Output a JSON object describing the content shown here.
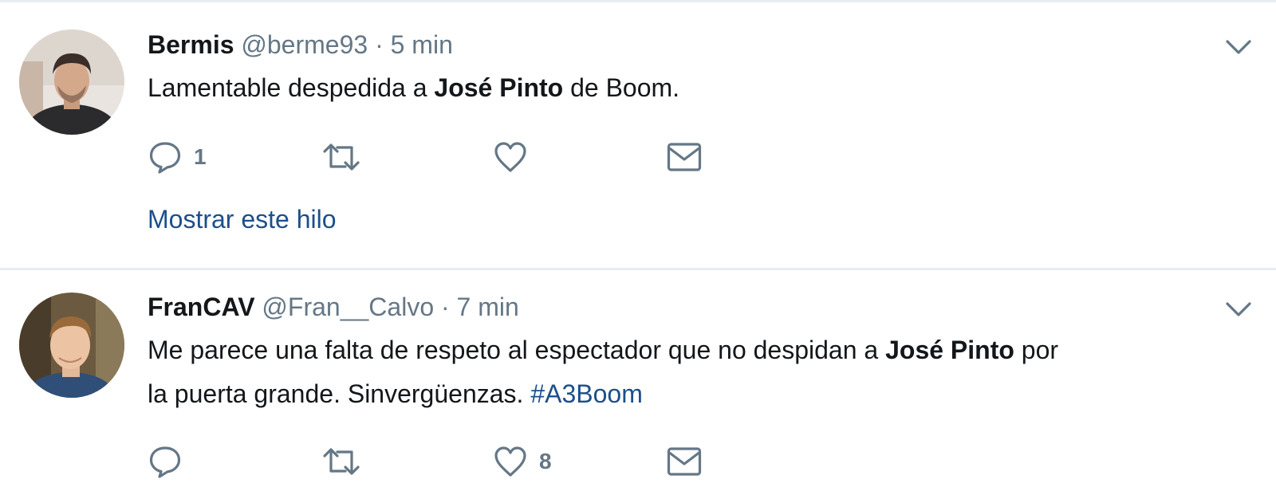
{
  "tweets": [
    {
      "name": "Bermis",
      "handle": "@berme93",
      "separator": "·",
      "time": "5 min",
      "text_parts": [
        "Lamentable despedida a ",
        "José Pinto",
        " de Boom."
      ],
      "reply_count": "1",
      "retweet_count": "",
      "like_count": "",
      "show_thread": "Mostrar este hilo"
    },
    {
      "name": "FranCAV",
      "handle": "@Fran__Calvo",
      "separator": "·",
      "time": "7 min",
      "line1_parts": [
        "Me parece una falta de respeto al espectador que no despidan a ",
        "José Pinto",
        " por"
      ],
      "line2_parts": [
        "la puerta grande. Sinvergüenzas. ",
        "#A3Boom"
      ],
      "reply_count": "",
      "retweet_count": "",
      "like_count": "8"
    }
  ],
  "icons": {
    "reply": "reply-icon",
    "retweet": "retweet-icon",
    "like": "heart-icon",
    "dm": "envelope-icon",
    "caret": "chevron-down-icon"
  },
  "colors": {
    "link": "#1b4f8a",
    "muted": "#657786",
    "divider": "#e6ecf0"
  }
}
